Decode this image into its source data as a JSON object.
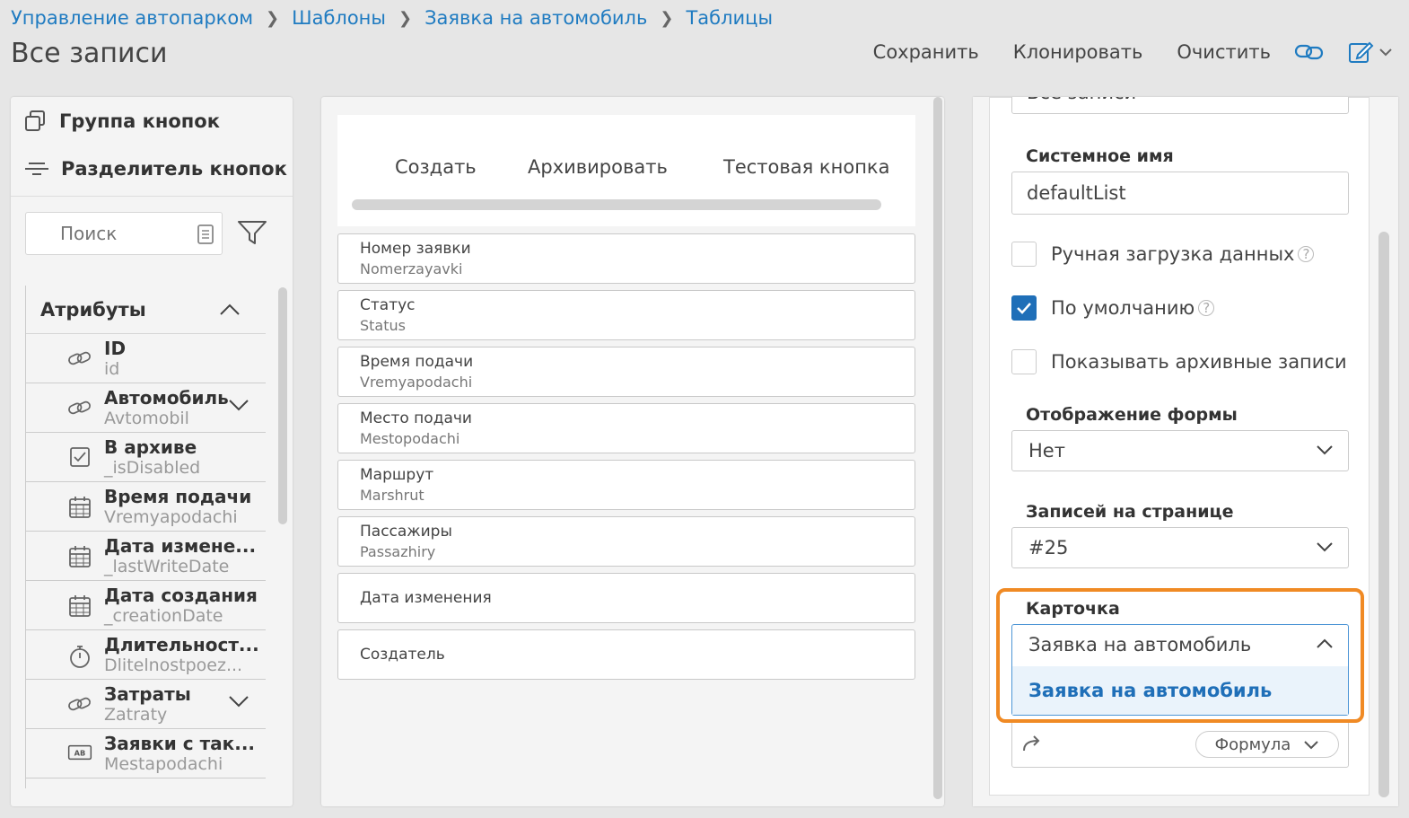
{
  "breadcrumb": [
    "Управление автопарком",
    "Шаблоны",
    "Заявка на автомобиль",
    "Таблицы"
  ],
  "page_title": "Все записи",
  "toolbar": {
    "save": "Сохранить",
    "clone": "Клонировать",
    "clear": "Очистить",
    "icons": [
      "link-icon",
      "edit-icon",
      "chevron-down-icon"
    ]
  },
  "left_panel": {
    "tools": [
      {
        "label": "Группа кнопок",
        "icon": "button-group-icon"
      },
      {
        "label": "Разделитель кнопок",
        "icon": "separator-icon"
      }
    ],
    "search_placeholder": "Поиск",
    "attributes_title": "Атрибуты",
    "attributes": [
      {
        "name": "ID",
        "system": "id",
        "icon": "link-icon",
        "expandable": false
      },
      {
        "name": "Автомобиль",
        "system": "Avtomobil",
        "icon": "link-icon",
        "expandable": true
      },
      {
        "name": "В архиве",
        "system": "_isDisabled",
        "icon": "checkbox-icon",
        "expandable": false
      },
      {
        "name": "Время подачи",
        "system": "Vremyapodachi",
        "icon": "calendar-icon",
        "expandable": false
      },
      {
        "name": "Дата измене...",
        "system": "_lastWriteDate",
        "icon": "calendar-icon",
        "expandable": false
      },
      {
        "name": "Дата создания",
        "system": "_creationDate",
        "icon": "calendar-icon",
        "expandable": false
      },
      {
        "name": "Длительност...",
        "system": "Dlitelnostpoez...",
        "icon": "stopwatch-icon",
        "expandable": false
      },
      {
        "name": "Затраты",
        "system": "Zatraty",
        "icon": "link-icon",
        "expandable": true
      },
      {
        "name": "Заявки с так...",
        "system": "Mestapodachi",
        "icon": "text-ab-icon",
        "expandable": false
      }
    ]
  },
  "middle_panel": {
    "buttons": [
      "Создать",
      "Архивировать",
      "Тестовая кнопка"
    ],
    "columns": [
      {
        "title": "Номер заявки",
        "system": "Nomerzayavki"
      },
      {
        "title": "Статус",
        "system": "Status"
      },
      {
        "title": "Время подачи",
        "system": "Vremyapodachi"
      },
      {
        "title": "Место подачи",
        "system": "Mestopodachi"
      },
      {
        "title": "Маршрут",
        "system": "Marshrut"
      },
      {
        "title": "Пассажиры",
        "system": "Passazhiry"
      },
      {
        "title": "Дата изменения",
        "system": ""
      },
      {
        "title": "Создатель",
        "system": ""
      }
    ]
  },
  "right_panel": {
    "name_value": "Все записи",
    "system_name_label": "Системное имя",
    "system_name_value": "defaultList",
    "manual_load_label": "Ручная загрузка данных",
    "manual_load_checked": false,
    "default_label": "По умолчанию",
    "default_checked": true,
    "show_archived_label": "Показывать архивные записи",
    "show_archived_checked": false,
    "form_display_label": "Отображение формы",
    "form_display_value": "Нет",
    "per_page_label": "Записей на странице",
    "per_page_value": "#25",
    "card_label": "Карточка",
    "card_value": "Заявка на автомобиль",
    "card_option": "Заявка на автомобиль",
    "formula_button": "Формула"
  },
  "colors": {
    "accent": "#1f7bc1",
    "checkbox_on": "#1f6fb8",
    "highlight": "#f08a24",
    "option_bg": "#eaf3fb"
  }
}
